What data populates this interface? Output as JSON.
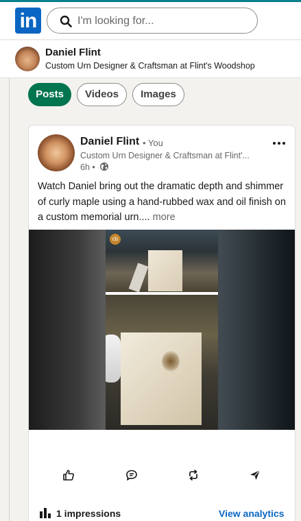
{
  "header": {
    "logo_text": "in",
    "search": {
      "placeholder": "I'm looking for..."
    }
  },
  "profile_bar": {
    "name": "Daniel Flint",
    "headline": "Custom Urn Designer & Craftsman at Flint's Woodshop"
  },
  "filters": [
    {
      "label": "Posts",
      "active": true
    },
    {
      "label": "Videos",
      "active": false
    },
    {
      "label": "Images",
      "active": false
    }
  ],
  "post": {
    "author": "Daniel Flint",
    "you_label": "• You",
    "headline": "Custom Urn Designer & Craftsman at Flint'...",
    "time": "6h •",
    "visibility_icon": "globe-icon",
    "menu_icon": "more-icon",
    "text": "Watch Daniel bring out the dramatic depth and shimmer of curly maple using a hand-rubbed wax and oil finish on a custom memorial urn....",
    "more_label": "more",
    "actions": [
      {
        "icon": "like-icon"
      },
      {
        "icon": "comment-icon"
      },
      {
        "icon": "repost-icon"
      },
      {
        "icon": "send-icon"
      }
    ],
    "impressions": "1 impressions",
    "analytics_label": "View analytics"
  },
  "colors": {
    "brand": "#0a66c2",
    "active_pill": "#01754f",
    "page_bg": "#f4f2ee"
  }
}
